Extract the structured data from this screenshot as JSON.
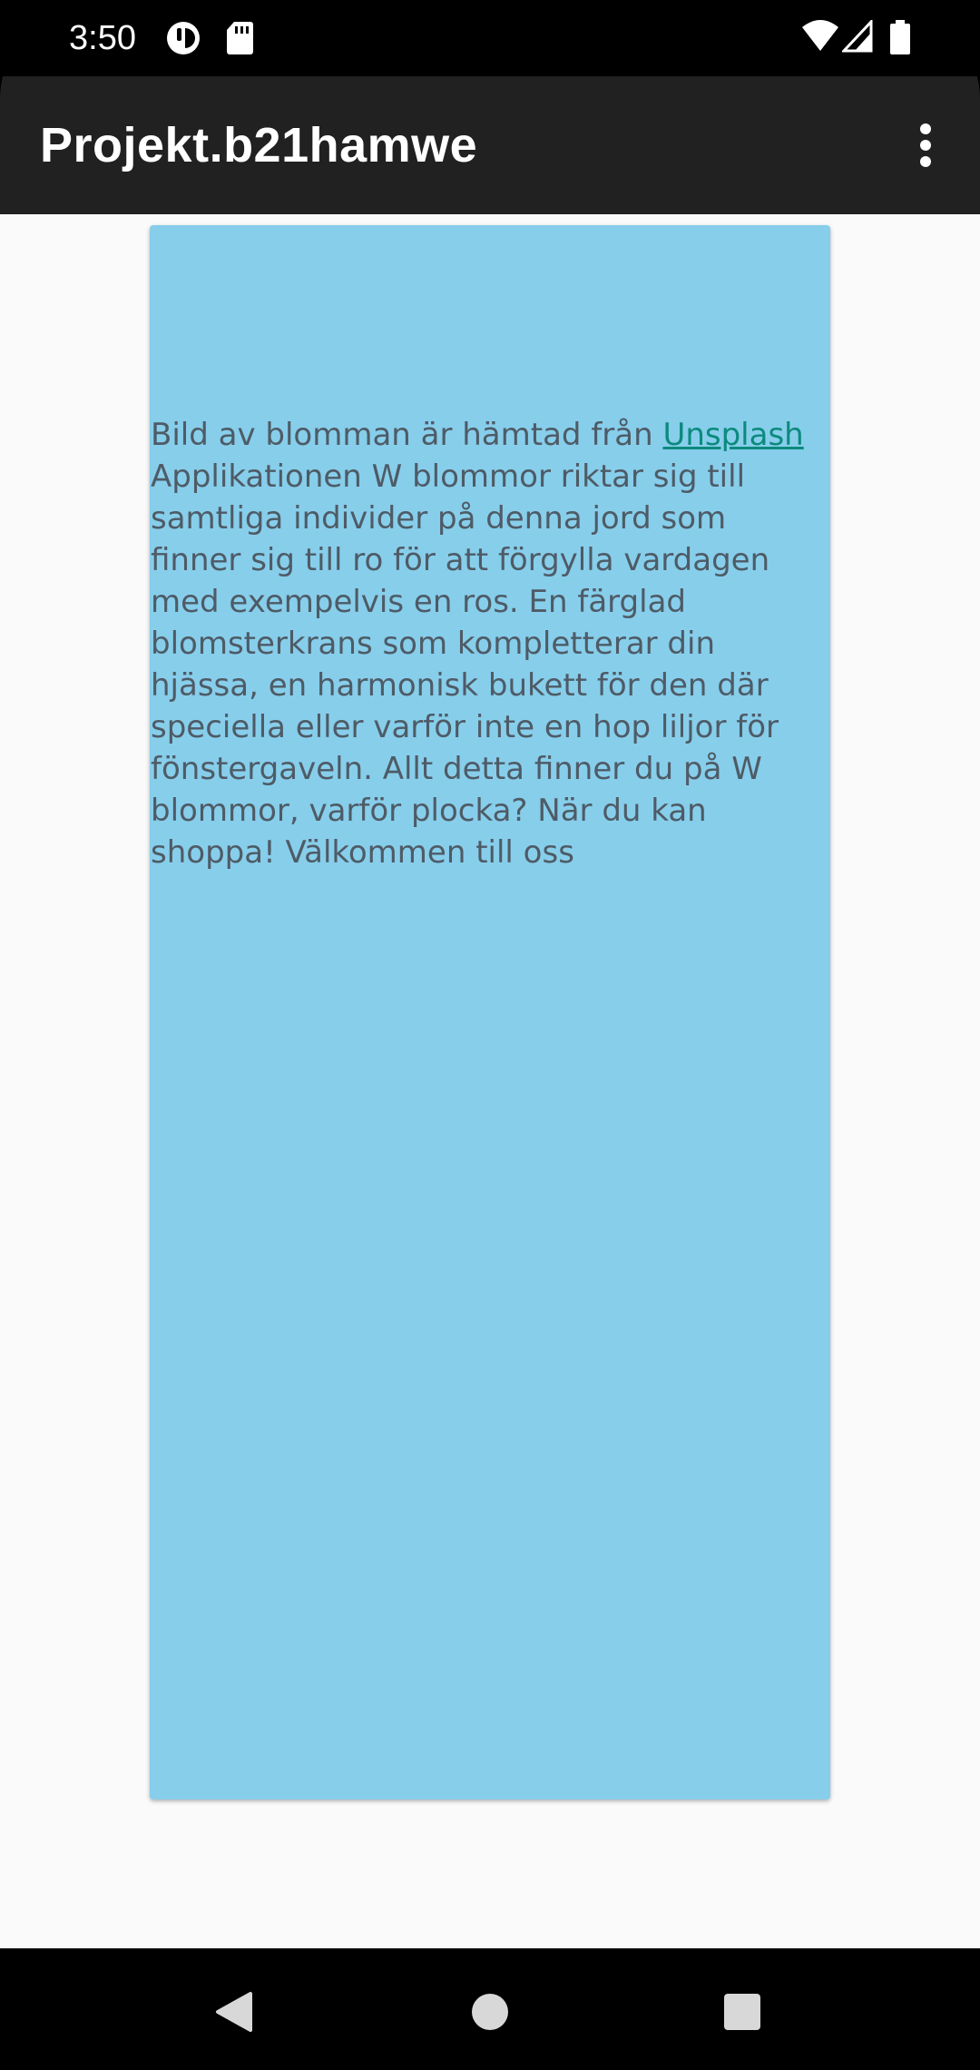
{
  "status_bar": {
    "time": "3:50",
    "icons": [
      "activity-circle-icon",
      "sd-card-icon",
      "wifi-icon",
      "cell-signal-icon",
      "battery-icon"
    ]
  },
  "app_bar": {
    "title": "Projekt.b21hamwe",
    "menu_icon": "more-vert-icon"
  },
  "card": {
    "background_color": "#87ceeb",
    "attribution_prefix": "Bild av blomman är hämtad från ",
    "attribution_link": "Unsplash",
    "description": "Applikationen W blommor riktar sig till samtliga individer på denna jord som finner sig till ro för att förgylla vardagen med exempelvis en ros. En färglad blomsterkrans som kompletterar din hjässa, en harmonisk bukett för den där speciella eller varför inte en hop liljor för fönstergaveln. Allt detta finner du på W blommor, varför plocka? När du kan shoppa! Välkommen till oss"
  },
  "nav_bar": {
    "buttons": [
      "back-icon",
      "home-icon",
      "recents-icon"
    ]
  },
  "colors": {
    "status_bar": "#000000",
    "app_bar": "#212121",
    "content_background": "#fafafa",
    "text": "#4e5b66",
    "link": "#0c8a7e"
  }
}
